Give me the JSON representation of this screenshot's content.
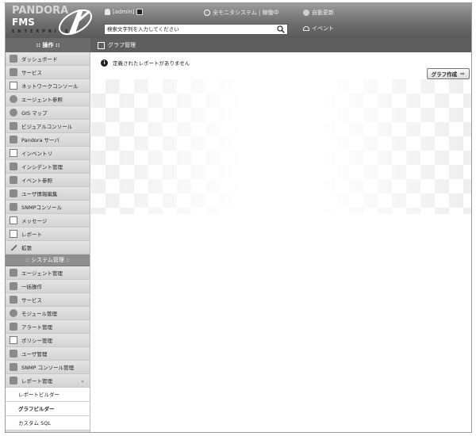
{
  "logo": {
    "brand": "PANDORA",
    "product": "FMS",
    "edition": "ENTERPRISE"
  },
  "header": {
    "user": "[admin]",
    "monitor_status": "全モニタシステム | 稼働中",
    "auto_refresh": "自動更新",
    "event": "イベント"
  },
  "search": {
    "placeholder": "検索文字列を入力してください"
  },
  "subbar": {
    "menu_title": ":: 操作 ::",
    "page_title": "グラフ管理"
  },
  "sidebar": {
    "items": [
      {
        "label": "ダッシュボード"
      },
      {
        "label": "サービス"
      },
      {
        "label": "ネットワークコンソール"
      },
      {
        "label": "エージェント参照"
      },
      {
        "label": "GIS マップ"
      },
      {
        "label": "ビジュアルコンソール"
      },
      {
        "label": "Pandora サーバ"
      },
      {
        "label": "インベントリ"
      },
      {
        "label": "インシデント管理"
      },
      {
        "label": "イベント参照"
      },
      {
        "label": "ユーザ情報編集"
      },
      {
        "label": "SNMPコンソール"
      },
      {
        "label": "メッセージ"
      },
      {
        "label": "レポート"
      },
      {
        "label": "拡張"
      }
    ],
    "admin_header": ":: システム管理 ::",
    "admin_items": [
      {
        "label": "エージェント管理"
      },
      {
        "label": "一括操作"
      },
      {
        "label": "サービス"
      },
      {
        "label": "モジュール管理"
      },
      {
        "label": "アラート管理"
      },
      {
        "label": "ポリシー管理"
      },
      {
        "label": "ユーザ管理"
      },
      {
        "label": "SNMP コンソール管理"
      },
      {
        "label": "レポート管理"
      }
    ],
    "sub_items": [
      {
        "label": "レポートビルダー"
      },
      {
        "label": "グラフビルダー"
      },
      {
        "label": "カスタム SQL"
      }
    ]
  },
  "main": {
    "info_message": "定義されたレポートがありません",
    "create_button": "グラフ作成"
  }
}
